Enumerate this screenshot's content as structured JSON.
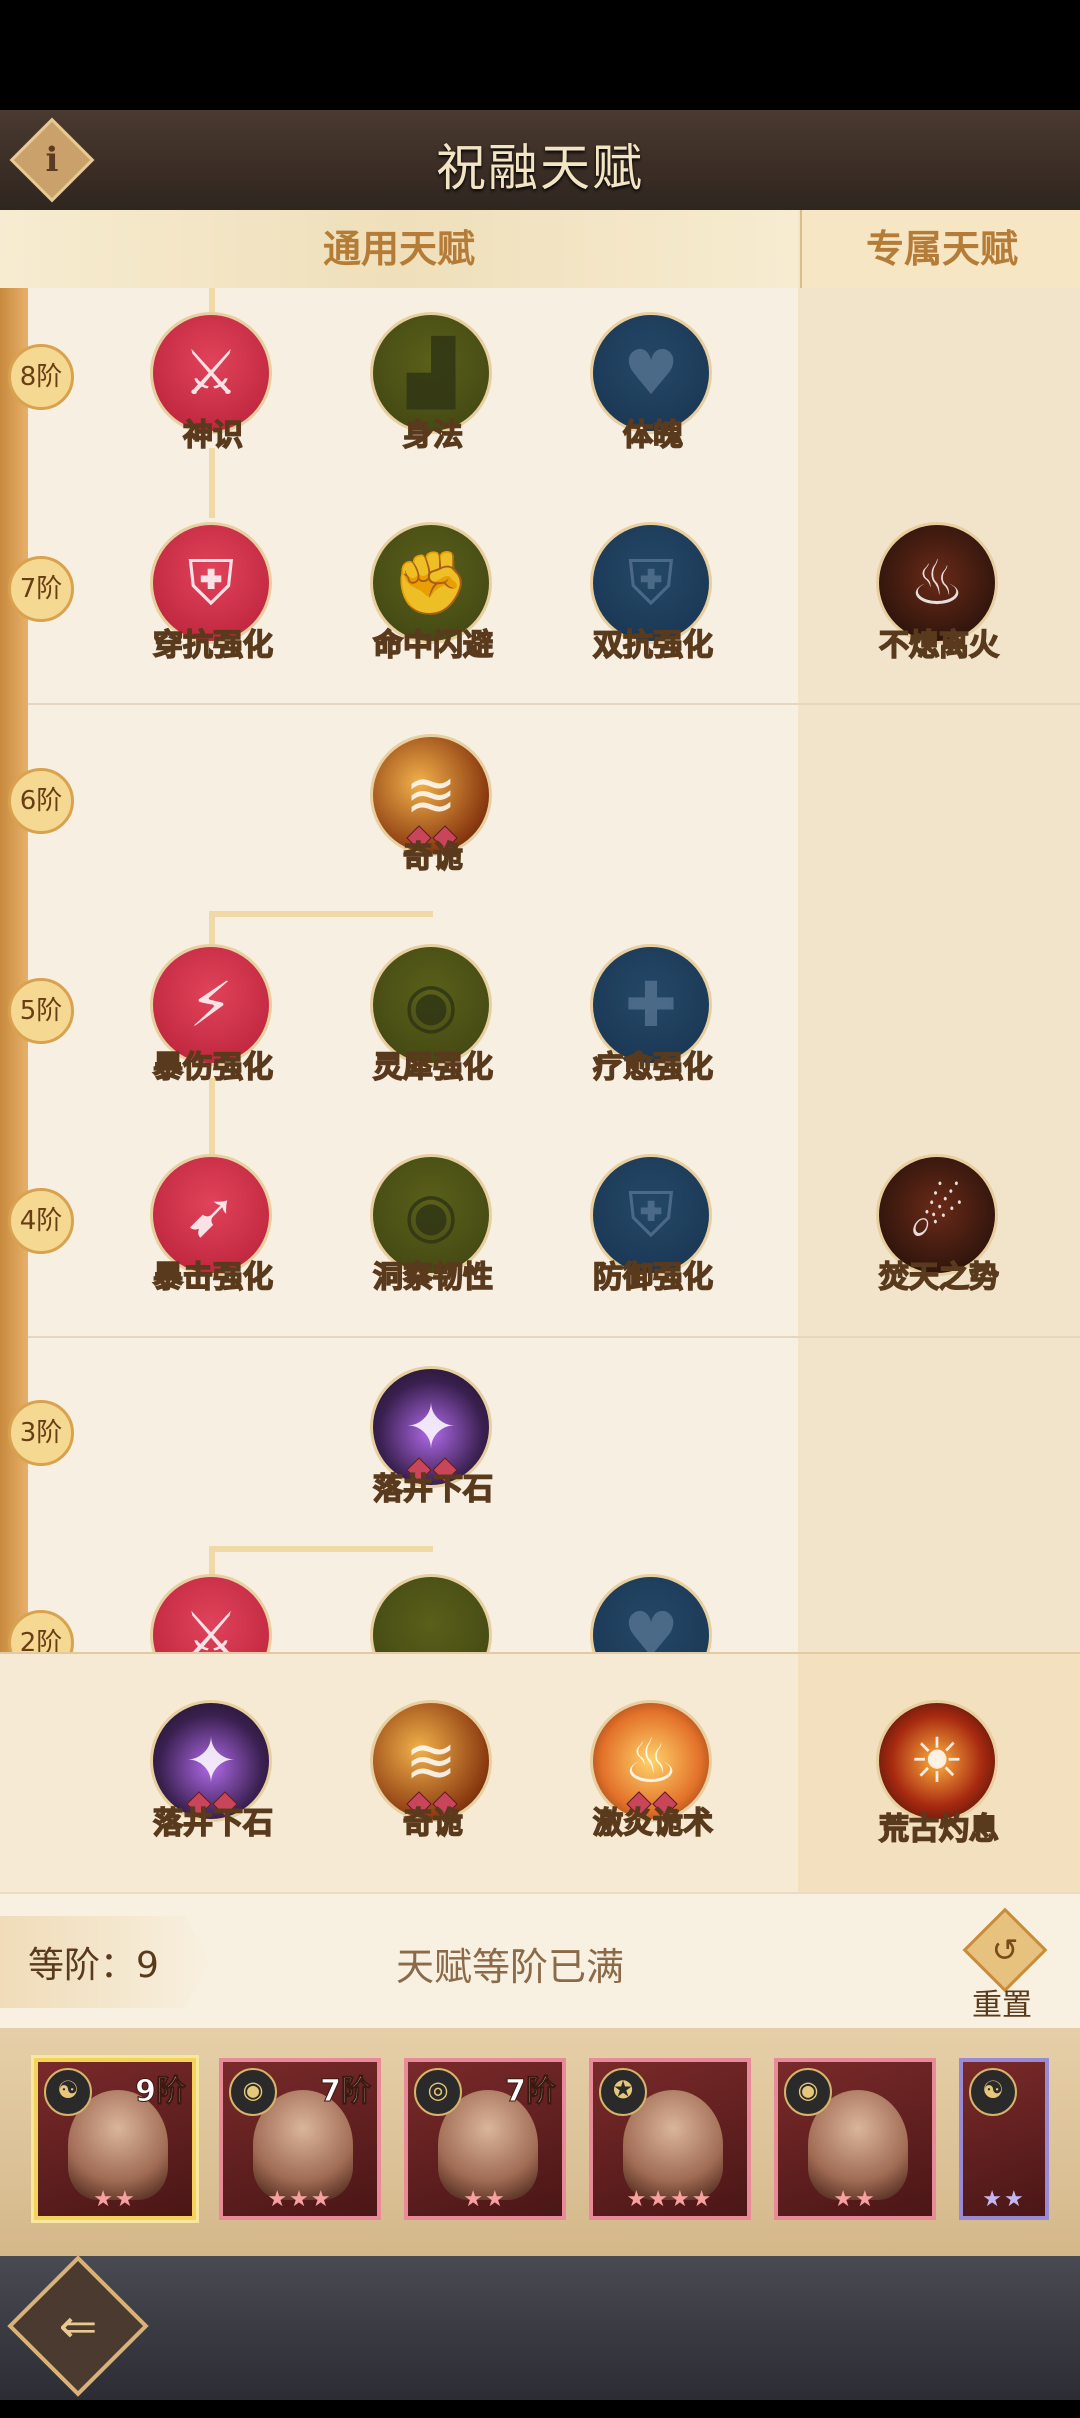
{
  "header": {
    "title": "祝融天赋",
    "info_icon": "i"
  },
  "tabs": {
    "general": "通用天赋",
    "exclusive": "专属天赋"
  },
  "tiers": [
    "8阶",
    "7阶",
    "6阶",
    "5阶",
    "4阶",
    "3阶",
    "2阶"
  ],
  "talents": {
    "t8": [
      "神识",
      "身法",
      "体魄"
    ],
    "t7": [
      "穿抗强化",
      "命中闪避",
      "双抗强化",
      "不熄离火"
    ],
    "t6": [
      "奇诡"
    ],
    "t5": [
      "暴伤强化",
      "灵犀强化",
      "疗愈强化"
    ],
    "t4": [
      "暴击强化",
      "洞察韧性",
      "防御强化",
      "焚天之势"
    ],
    "t3": [
      "落井下石"
    ]
  },
  "selected": [
    "落井下石",
    "奇诡",
    "激炎诡术",
    "荒古灼息"
  ],
  "level": {
    "label": "等阶：",
    "value": "9",
    "status": "天赋等阶已满",
    "reset_label": "重置"
  },
  "heroes": [
    {
      "tier": "9阶",
      "stars": "★★"
    },
    {
      "tier": "7阶",
      "stars": "★★★"
    },
    {
      "tier": "7阶",
      "stars": "★★"
    },
    {
      "tier": "",
      "stars": "★★★★"
    },
    {
      "tier": "",
      "stars": "★★"
    },
    {
      "tier": "",
      "stars": "★★"
    }
  ]
}
